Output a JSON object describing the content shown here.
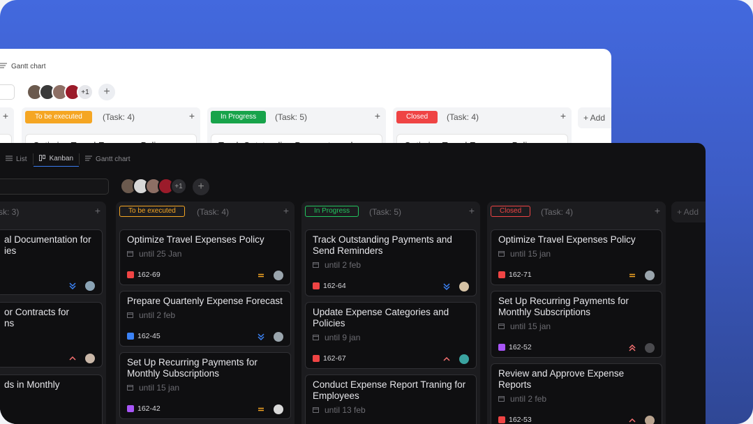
{
  "light": {
    "tab_gantt": "Gantt chart",
    "avatars_more": "+1",
    "add_member": "+",
    "columns": [
      {
        "label": "",
        "count": "",
        "plus": "+",
        "card": ""
      },
      {
        "label": "To be executed",
        "count": "(Task: 4)",
        "plus": "+",
        "card": "Optimize Travel Expenses Policy",
        "color": "#f5a623"
      },
      {
        "label": "In Progress",
        "count": "(Task: 5)",
        "plus": "+",
        "card": "Track Outstanding Payments and",
        "color": "#17a34a"
      },
      {
        "label": "Closed",
        "count": "(Task: 4)",
        "plus": "+",
        "card": "Optimize Travel Expenses Policy",
        "color": "#ef4444"
      }
    ],
    "add_column": "+  Add"
  },
  "dark": {
    "tabs": {
      "list": "List",
      "kanban": "Kanban",
      "gantt": "Gantt chart"
    },
    "avatars_more": "+1",
    "add_member": "+",
    "add_column": "+  Add",
    "columns": [
      {
        "label": "",
        "count": "sk: 3)",
        "plus": "+",
        "cards": [
          {
            "title": "al Documentation for\nies",
            "date": "",
            "id": ""
          },
          {
            "title": "or Contracts for\nns",
            "date": "",
            "id": ""
          },
          {
            "title": "ds in Monthly",
            "date": "",
            "id": ""
          }
        ]
      },
      {
        "label": "To be executed",
        "count": "(Task: 4)",
        "plus": "+",
        "color": "#f5a623",
        "cards": [
          {
            "title": "Optimize Travel Expenses Policy",
            "date": "until 25 Jan",
            "id": "162-69",
            "tag": "#ef4444",
            "prio": "medium"
          },
          {
            "title": "Prepare Quartenly Expense Forecast",
            "date": "until 2 feb",
            "id": "162-45",
            "tag": "#3b82f6",
            "prio": "low"
          },
          {
            "title": "Set Up Recurring Payments for\nMonthly Subscriptions",
            "date": "until 15 jan",
            "id": "162-42",
            "tag": "#a855f7",
            "prio": "medium"
          }
        ]
      },
      {
        "label": "In Progress",
        "count": "(Task: 5)",
        "plus": "+",
        "color": "#22c55e",
        "cards": [
          {
            "title": "Track Outstanding Payments and\nSend Reminders",
            "date": "until 2 feb",
            "id": "162-64",
            "tag": "#ef4444",
            "prio": "low"
          },
          {
            "title": "Update Expense Categories and\nPolicies",
            "date": "until 9 jan",
            "id": "162-67",
            "tag": "#ef4444",
            "prio": "high"
          },
          {
            "title": "Conduct Expense Report Traning for\nEmployees",
            "date": "until 13 feb",
            "id": "",
            "tag": "",
            "prio": ""
          }
        ]
      },
      {
        "label": "Closed",
        "count": "(Task: 4)",
        "plus": "+",
        "color": "#ef4444",
        "cards": [
          {
            "title": "Optimize Travel Expenses Policy",
            "date": "until 15 jan",
            "id": "162-71",
            "tag": "#ef4444",
            "prio": "medium"
          },
          {
            "title": "Set Up Recurring Payments for\nMonthly Subscriptions",
            "date": "until 15 jan",
            "id": "162-52",
            "tag": "#a855f7",
            "prio": "urgent"
          },
          {
            "title": "Review and Approve Expense\nReports",
            "date": "until 2 feb",
            "id": "162-53",
            "tag": "#ef4444",
            "prio": "high"
          }
        ]
      }
    ]
  },
  "colors": {
    "brand_blue": "#4369de",
    "priority_medium": "#f5a623",
    "priority_low": "#3b82f6",
    "priority_high": "#f87171"
  }
}
